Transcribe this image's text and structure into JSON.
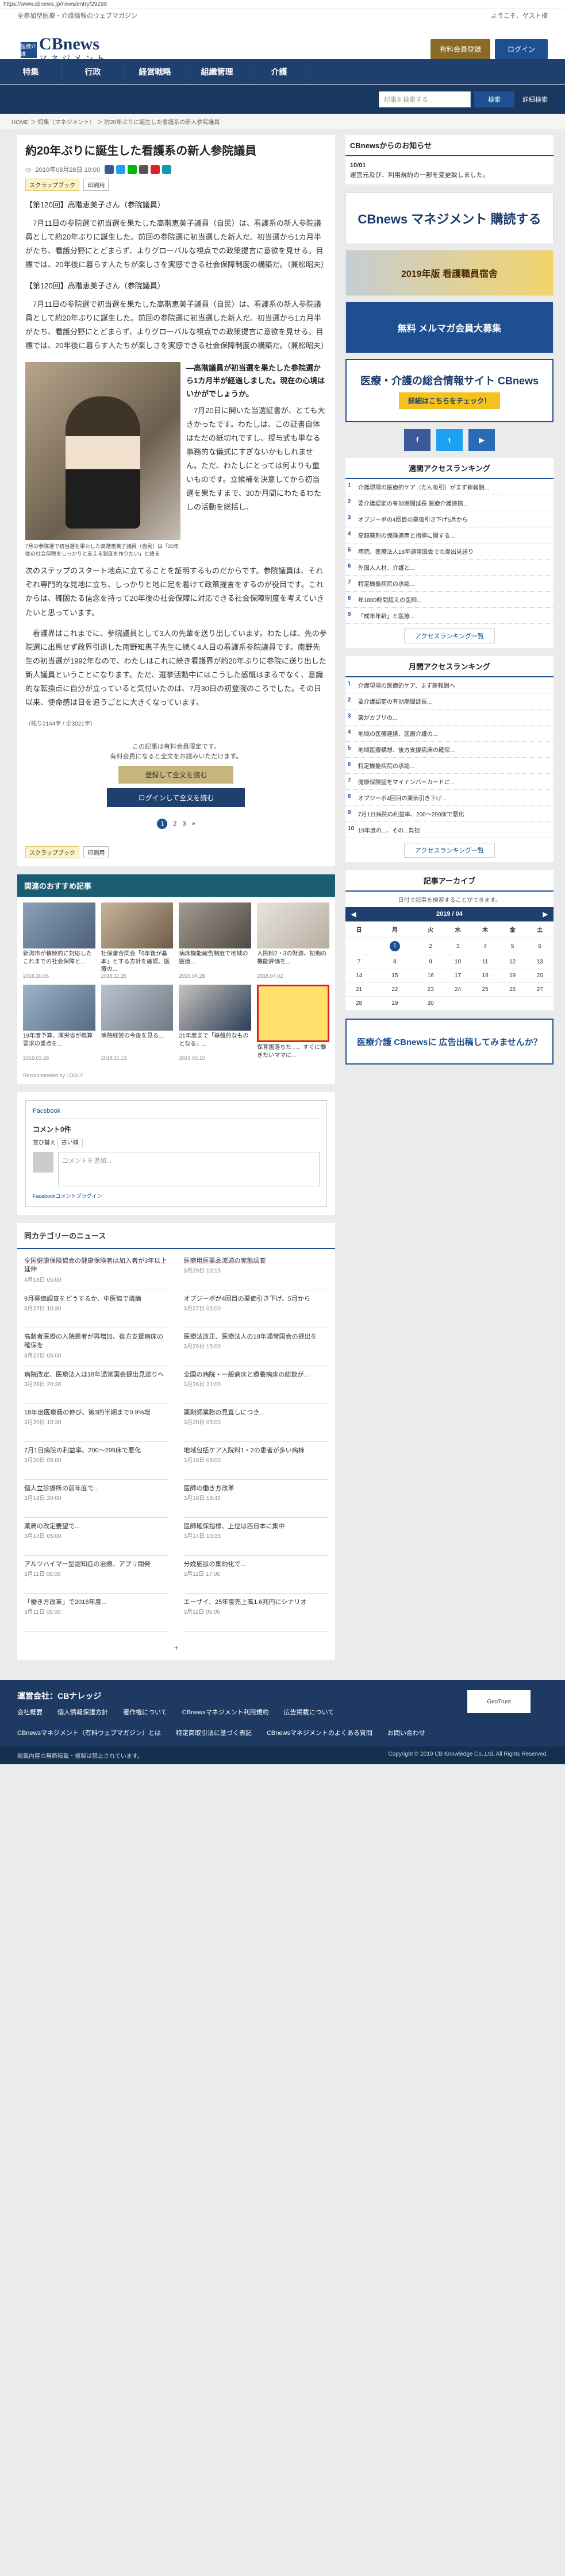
{
  "url": "https://www.cbnews.jp/news/entry/29299",
  "topbar": {
    "left": "全参加型医療・介護情報のウェブマガジン",
    "right": "ようこそ、ゲスト様"
  },
  "logo": {
    "badge": "医療介護",
    "name": "CBnews",
    "sub": "マネジメント"
  },
  "header": {
    "btn_member": "有料会員登録",
    "btn_login": "ログイン"
  },
  "nav": [
    "特集",
    "行政",
    "経営戦略",
    "組織管理",
    "介護"
  ],
  "search": {
    "placeholder": "記事を検索する",
    "button": "検索",
    "advanced": "詳細検索"
  },
  "breadcrumb": "HOME ＞ 特集（マネジメント） ＞ 約20年ぶりに誕生した看護系の新人参院議員",
  "article": {
    "title": "約20年ぶりに誕生した看護系の新人参院議員",
    "date": "2010年08月28日 10:00",
    "tag1": "スクラップブック",
    "tag2": "印刷用",
    "section1_head": "【第120回】高階恵美子さん（参院議員）",
    "para1": "　7月11日の参院選で初当選を果たした高階恵美子議員（自民）は、看護系の新人参院議員として約20年ぶりに誕生した。前回の参院選に初当選した新人だ。初当選から1カ月半がたち、看護分野にとどまらず、よりグローバルな視点での政策提言に意欲を見せる。目標では、20年後に暮らす人たちが楽しさを実感できる社会保障制度の構築だ。（兼松昭夫）",
    "section2_head": "【第120回】高階恵美子さん（参院議員）",
    "para2": "　7月11日の参院選で初当選を果たした高階恵美子議員（自民）は、看護系の新人参院議員として約20年ぶりに誕生した。前回の参院選に初当選した新人だ。初当選から1カ月半がたち、看護分野にとどまらず、よりグローバルな視点での政策提言に意欲を見せる。目標では、20年後に暮らす人たちが楽しさを実感できる社会保障制度の構築だ。（兼松昭夫）",
    "lead": "―高階議員が初当選を果たした参院選から1カ月半が経過しました。現在の心境はいかがでしょうか。",
    "para3": "　7月20日に開いた当選証書が、とても大きかったです。わたしは、この証書自体はただの紙切れですし、授与式も単なる事務的な儀式にすぎないかもしれません。ただ、わたしにとっては何よりも重いものです。立候補を決意してから初当選を果たすまで、30か月間にわたるわたしの活動を総括し、",
    "para4": "次のステップのスタート地点に立てることを証明するものだからです。参院議員は、それぞれ専門的な見地に立ち、しっかりと地に足を着けて政策提言をするのが役目です。これからは、確固たる信念を持って20年後の社会保障に対応できる社会保障制度を考えていきたいと思っています。",
    "para5": "　看護界はこれまでに、参院議員として3人の先輩を送り出しています。わたしは、先の参院選に出馬せず政界引退した南野知惠子先生に続く4人目の看護系参院議員です。南野先生の初当選が1992年なので、わたしはこれに続き看護界が約20年ぶりに参院に送り出した新人議員ということになります。ただ、選挙活動中にはこうした感慨はまるでなく、意識的な転換点に自分が立っていると気付いたのは、7月30日の初登院のころでした。その日以来、使命感は日を追うごとに大きくなっています。",
    "caption": "7月の参院選で初当選を果たした高階恵美子議員（自民）は「20年後の社会保障をしっかりと支える制度を作りたい」と語る",
    "chars": "（残り2144字 / 全3021字）",
    "paywall_text1": "この記事は有料会員限定です。",
    "paywall_text2": "有料会員になると全文をお読みいただけます。",
    "paywall_btn1": "登録して全文を読む",
    "paywall_btn2": "ログインして全文を読む",
    "pages": [
      "1",
      "2",
      "3",
      "»"
    ]
  },
  "recommended": {
    "heading": "関連のおすすめ記事",
    "items": [
      {
        "title": "新潟市が積極的に対応したこれまでの社会保障と...",
        "date": "2016.10.05"
      },
      {
        "title": "社保審合同会「5年後が基本」とする方針を確認、医療の...",
        "date": "2016.11.25"
      },
      {
        "title": "病床機能報告制度で地域の医療...",
        "date": "2016.04.28"
      },
      {
        "title": "入院料2・3の財源、初期の機能評価を...",
        "date": "2018.04.02"
      },
      {
        "title": "19年度予算、厚労省が概算要求の重点を...",
        "date": "2019.03.28"
      },
      {
        "title": "病院経営の今後を見る...",
        "date": "2018.11.13"
      },
      {
        "title": "21年度まで「基盤的なものとなる」...",
        "date": "2019.03.15"
      },
      {
        "title": "保育園落ちた…、すぐに働きたいママに...",
        "date": ""
      }
    ],
    "powered": "Recommended by LOGLY"
  },
  "facebook": {
    "tab": "Facebook",
    "comments": "コメント0件",
    "sort_label": "並び替え",
    "sort_value": "古い順",
    "input_placeholder": "コメントを追加...",
    "plugin": "Facebookコメントプラグイン"
  },
  "same_category": {
    "heading": "同カテゴリーのニュース",
    "items": [
      {
        "title": "全国健康保険協会の健康保険者は加入者が3年以上延伸",
        "date": "4月18日 05:00"
      },
      {
        "title": "医療用医薬品流通の実態調査",
        "date": "3月29日 10:15"
      },
      {
        "title": "9月薬価調査をどうするか、中医協で議論",
        "date": "3月27日 10:30"
      },
      {
        "title": "オプジーボが4回目の薬価引き下げ、5月から",
        "date": "3月27日 05:00"
      },
      {
        "title": "高齢者医療の入院患者が再増加、後方支援病床の確保を",
        "date": "3月27日 05:00"
      },
      {
        "title": "医療法改正、医療法人の18年通常国会の提出を",
        "date": "3月26日 15:00"
      },
      {
        "title": "病院改定、医療法人は18年通常国会提出見送りへ",
        "date": "3月26日 20:30"
      },
      {
        "title": "全国の病院・一般病床と療養病床の総数が...",
        "date": "3月26日 21:00"
      },
      {
        "title": "18年度医療費の伸び、第3四半期まで0.9%増",
        "date": "3月20日 10:30"
      },
      {
        "title": "薬剤師業務の見直しにつき...",
        "date": "3月20日 05:00"
      },
      {
        "title": "7月1日病院の利益率、200～299床で悪化",
        "date": "3月20日 05:00"
      },
      {
        "title": "地域包括ケア入院料1・2の患者が多い病棟",
        "date": "3月18日 05:00"
      },
      {
        "title": "個人立診療所の前年度で...",
        "date": "3月18日 20:00"
      },
      {
        "title": "医師の働き方改革",
        "date": "3月18日 18:45"
      },
      {
        "title": "薬局の改定要望で...",
        "date": "3月14日 05:00"
      },
      {
        "title": "医師確保指標、上位は西日本に集中",
        "date": "3月14日 10:35"
      },
      {
        "title": "アルツハイマー型認知症の治療、アプリ開発",
        "date": "3月11日 05:00"
      },
      {
        "title": "分娩施設の集約化で...",
        "date": "3月11日 17:00"
      },
      {
        "title": "「働き方改革」で2018年度...",
        "date": "3月11日 05:00"
      },
      {
        "title": "エーザイ、25年度売上高1.6兆円にシナリオ",
        "date": "3月11日 05:00"
      }
    ]
  },
  "sidebar": {
    "notice_head": "CBnewsからのお知らせ",
    "notice_date": "10/01",
    "notice_text": "運営元及び、利用規約の一部を変更致しました。",
    "banner1": "CBnews マネジメント 購読する",
    "banner2": "2019年版 看護職員宿舎",
    "banner3": "無料 メルマガ会員大募集",
    "banner4_title": "医療・介護の総合情報サイト CBnews",
    "banner4_btn": "詳細はこちらをチェック！",
    "social": [
      "f",
      "t",
      "▶"
    ],
    "weekly_head": "週間アクセスランキング",
    "weekly": [
      "介護現場の医療的ケア（たん吸引）がまず新報酬...",
      "要介護認定の有効期間延長 医療介護連携...",
      "オプジーボの4回目の薬価引き下げ5月から",
      "高額薬剤の保険適用と指導に関する...",
      "病院、医療法人18年通常国会での提出見送り",
      "外国人人材、介護と...",
      "特定機能病院の承認...",
      "年1800時間超えの医師...",
      "「成年年齢」と医療..."
    ],
    "weekly_more": "アクセスランキング一覧",
    "monthly_head": "月間アクセスランキング",
    "monthly": [
      "介護現場の医療的ケア、まず新報酬へ",
      "要介護認定の有効期間延長...",
      "薬がカプリの...",
      "地域の医療連携、医療介護の...",
      "地域医療構想、後方支援病床の確保...",
      "特定機能病院の承認...",
      "健康保険証をマイナンバーカードに...",
      "オプジーボ4回目の薬価引き下げ...",
      "7月1日病院の利益率、200～299床で悪化",
      "19年度の...、その...負担"
    ],
    "monthly_more": "アクセスランキング一覧",
    "archive_head": "記事アーカイブ",
    "archive_sub": "日付で記事を検索することができます。",
    "calendar_month": "2019 / 04",
    "weekdays": [
      "日",
      "月",
      "火",
      "水",
      "木",
      "金",
      "土"
    ],
    "weeks": [
      [
        "",
        "1",
        "2",
        "3",
        "4",
        "5",
        "6"
      ],
      [
        "7",
        "8",
        "9",
        "10",
        "11",
        "12",
        "13"
      ],
      [
        "14",
        "15",
        "16",
        "17",
        "18",
        "19",
        "20"
      ],
      [
        "21",
        "22",
        "23",
        "24",
        "25",
        "26",
        "27"
      ],
      [
        "28",
        "29",
        "30",
        "",
        "",
        "",
        ""
      ]
    ],
    "ad_banner": "医療介護 CBnewsに 広告出稿してみませんか？"
  },
  "footer": {
    "company": "運営会社：CBナレッジ",
    "links": [
      "会社概要",
      "個人情報保護方針",
      "著作権について",
      "CBnewsマネジメント利用規約",
      "広告掲載について",
      "CBnewsマネジメント（有料ウェブマガジン）とは",
      "特定商取引法に基づく表記",
      "CBnewsマネジメントのよくある質問",
      "お問い合わせ"
    ],
    "seal": "GeoTrust",
    "copyright_left": "掲載内容の無断転載・複製は禁止されています。",
    "copyright_right": "Copyright © 2019 CB Knowledge Co.,Ltd. All Rights Reserved."
  }
}
